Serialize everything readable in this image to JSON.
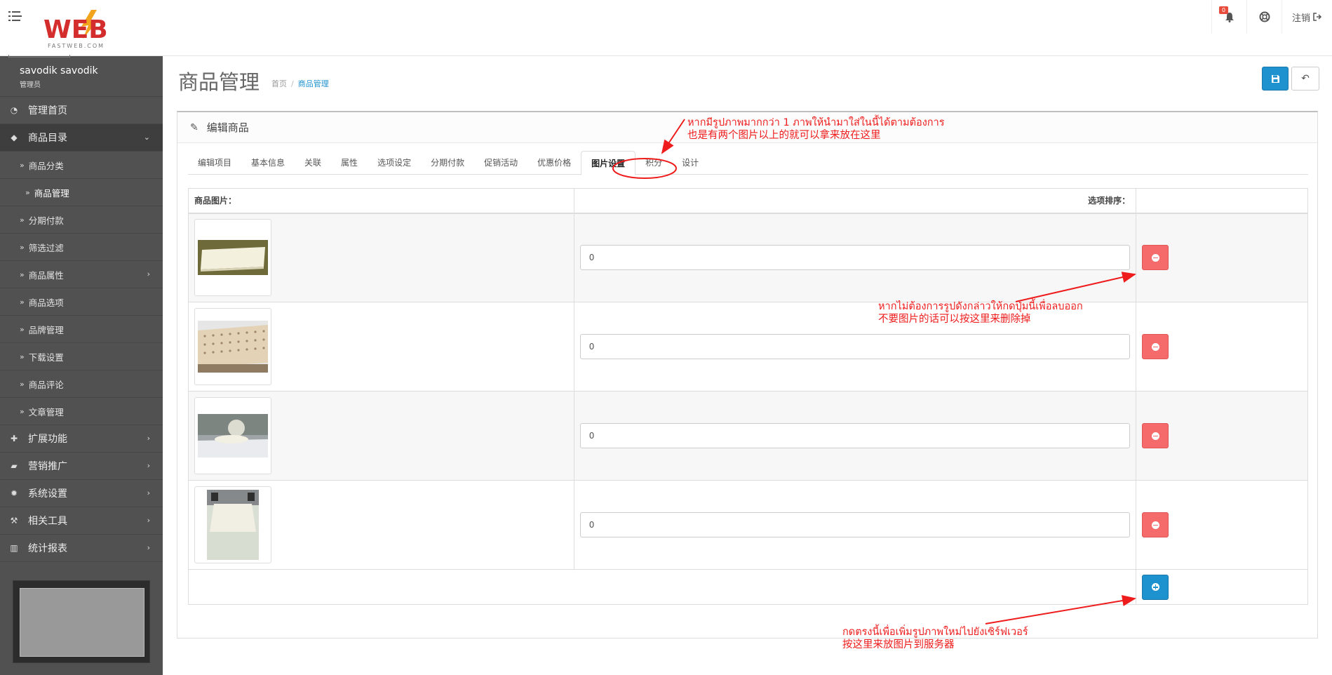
{
  "header": {
    "notification_count": "0",
    "logout_label": "注销",
    "logo_text": "WEB",
    "logo_subtext": "FASTWEB.COM"
  },
  "sidebar": {
    "user_name": "savodik savodik",
    "user_role": "管理员",
    "items": [
      {
        "label": "管理首页",
        "icon": "dashboard-icon"
      },
      {
        "label": "商品目录",
        "icon": "tags-icon"
      },
      {
        "label": "商品分类"
      },
      {
        "label": "商品管理"
      },
      {
        "label": "分期付款"
      },
      {
        "label": "筛选过滤"
      },
      {
        "label": "商品属性"
      },
      {
        "label": "商品选项"
      },
      {
        "label": "品牌管理"
      },
      {
        "label": "下载设置"
      },
      {
        "label": "商品评论"
      },
      {
        "label": "文章管理"
      },
      {
        "label": "扩展功能",
        "icon": "puzzle-icon"
      },
      {
        "label": "营销推广",
        "icon": "cart-icon"
      },
      {
        "label": "系统设置",
        "icon": "gear-icon"
      },
      {
        "label": "相关工具",
        "icon": "wrench-icon"
      },
      {
        "label": "统计报表",
        "icon": "bar-chart-icon"
      }
    ]
  },
  "page": {
    "title": "商品管理",
    "breadcrumb": [
      "首页",
      "商品管理"
    ],
    "panel_title": "编辑商品"
  },
  "tabs": [
    "编辑项目",
    "基本信息",
    "关联",
    "属性",
    "选项设定",
    "分期付款",
    "促销活动",
    "优惠价格",
    "图片设置",
    "积分",
    "设计"
  ],
  "active_tab": "图片设置",
  "table": {
    "col_image": "商品图片：",
    "col_sort": "选项排序：",
    "rows": [
      {
        "sort_order": "0"
      },
      {
        "sort_order": "0"
      },
      {
        "sort_order": "0"
      },
      {
        "sort_order": "0"
      }
    ]
  },
  "annotations": {
    "tab_note_th": "หากมีรูปภาพมากกว่า 1 ภาพให้นำมาใส่ในนี้ได้ตามต้องการ",
    "tab_note_cn": "也是有两个图片以上的就可以拿来放在这里",
    "delete_note_th": "หากไม่ต้องการรูปดังกล่าวให้กดปุ่มนี้เพื่อลบออก",
    "delete_note_cn": "不要图片的话可以按这里来删除掉",
    "add_note_th": "กดตรงนี้เพื่อเพิ่มรูปภาพใหม่ไปยังเซิร์ฟเวอร์",
    "add_note_cn": "按这里来放图片到服务器"
  },
  "colors": {
    "sidebar_bg": "#515151",
    "primary": "#1e91cf",
    "danger": "#f56b6b",
    "annotation": "#ee1c1c"
  }
}
